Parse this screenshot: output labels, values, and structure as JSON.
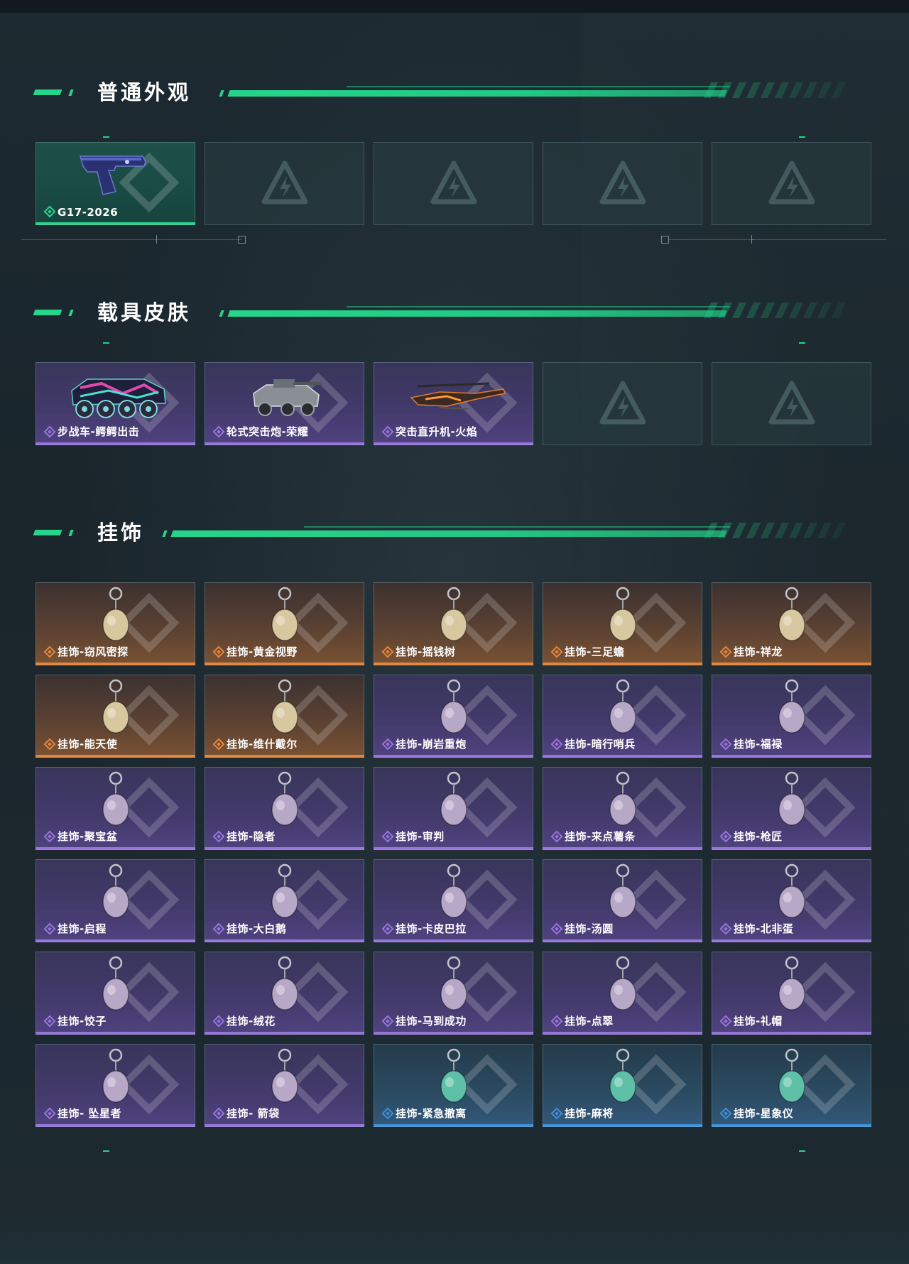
{
  "sections": {
    "normal": {
      "title": "普通外观",
      "items": [
        {
          "label": "G17-2026",
          "tier": "green",
          "icon": "pistol-icon"
        },
        {
          "label": "",
          "tier": "empty"
        },
        {
          "label": "",
          "tier": "empty"
        },
        {
          "label": "",
          "tier": "empty"
        },
        {
          "label": "",
          "tier": "empty"
        }
      ]
    },
    "vehicle": {
      "title": "载具皮肤",
      "items": [
        {
          "label": "步战车-鳄鳄出击",
          "tier": "purple",
          "icon": "armored-vehicle-icon"
        },
        {
          "label": "轮式突击炮-荣耀",
          "tier": "purple",
          "icon": "assault-gun-icon"
        },
        {
          "label": "突击直升机-火焰",
          "tier": "purple",
          "icon": "helicopter-icon"
        },
        {
          "label": "",
          "tier": "empty"
        },
        {
          "label": "",
          "tier": "empty"
        }
      ]
    },
    "charm": {
      "title": "挂饰",
      "items": [
        {
          "label": "挂饰-窃风密探",
          "tier": "orange",
          "icon": "charm-icon"
        },
        {
          "label": "挂饰-黄金视野",
          "tier": "orange",
          "icon": "charm-icon"
        },
        {
          "label": "挂饰-摇钱树",
          "tier": "orange",
          "icon": "charm-icon"
        },
        {
          "label": "挂饰-三足蟾",
          "tier": "orange",
          "icon": "charm-icon"
        },
        {
          "label": "挂饰-祥龙",
          "tier": "orange",
          "icon": "charm-icon"
        },
        {
          "label": "挂饰-能天使",
          "tier": "orange",
          "icon": "charm-icon"
        },
        {
          "label": "挂饰-维什戴尔",
          "tier": "orange",
          "icon": "charm-icon"
        },
        {
          "label": "挂饰-崩岩重炮",
          "tier": "purple",
          "icon": "charm-icon"
        },
        {
          "label": "挂饰-暗行哨兵",
          "tier": "purple",
          "icon": "charm-icon"
        },
        {
          "label": "挂饰-福禄",
          "tier": "purple",
          "icon": "charm-icon"
        },
        {
          "label": "挂饰-聚宝盆",
          "tier": "purple",
          "icon": "charm-icon"
        },
        {
          "label": "挂饰-隐者",
          "tier": "purple",
          "icon": "charm-icon"
        },
        {
          "label": "挂饰-审判",
          "tier": "purple",
          "icon": "charm-icon"
        },
        {
          "label": "挂饰-来点薯条",
          "tier": "purple",
          "icon": "charm-icon"
        },
        {
          "label": "挂饰-枪匠",
          "tier": "purple",
          "icon": "charm-icon"
        },
        {
          "label": "挂饰-启程",
          "tier": "purple",
          "icon": "charm-icon"
        },
        {
          "label": "挂饰-大白鹅",
          "tier": "purple",
          "icon": "charm-icon"
        },
        {
          "label": "挂饰-卡皮巴拉",
          "tier": "purple",
          "icon": "charm-icon"
        },
        {
          "label": "挂饰-汤圆",
          "tier": "purple",
          "icon": "charm-icon"
        },
        {
          "label": "挂饰-北非蛋",
          "tier": "purple",
          "icon": "charm-icon"
        },
        {
          "label": "挂饰-饺子",
          "tier": "purple",
          "icon": "charm-icon"
        },
        {
          "label": "挂饰-绒花",
          "tier": "purple",
          "icon": "charm-icon"
        },
        {
          "label": "挂饰-马到成功",
          "tier": "purple",
          "icon": "charm-icon"
        },
        {
          "label": "挂饰-点翠",
          "tier": "purple",
          "icon": "charm-icon"
        },
        {
          "label": "挂饰-礼帽",
          "tier": "purple",
          "icon": "charm-icon"
        },
        {
          "label": "挂饰- 坠星者",
          "tier": "purple",
          "icon": "charm-icon"
        },
        {
          "label": "挂饰- 箭袋",
          "tier": "purple",
          "icon": "charm-icon"
        },
        {
          "label": "挂饰-紧急撤离",
          "tier": "blue",
          "icon": "charm-icon"
        },
        {
          "label": "挂饰-麻将",
          "tier": "blue",
          "icon": "charm-icon"
        },
        {
          "label": "挂饰-星象仪",
          "tier": "blue",
          "icon": "charm-icon"
        }
      ]
    }
  },
  "colors": {
    "accent": "#25d58a",
    "orange": "#e8853a",
    "purple": "#9a73dc",
    "blue": "#3b8fd8",
    "green": "#25d58a"
  }
}
